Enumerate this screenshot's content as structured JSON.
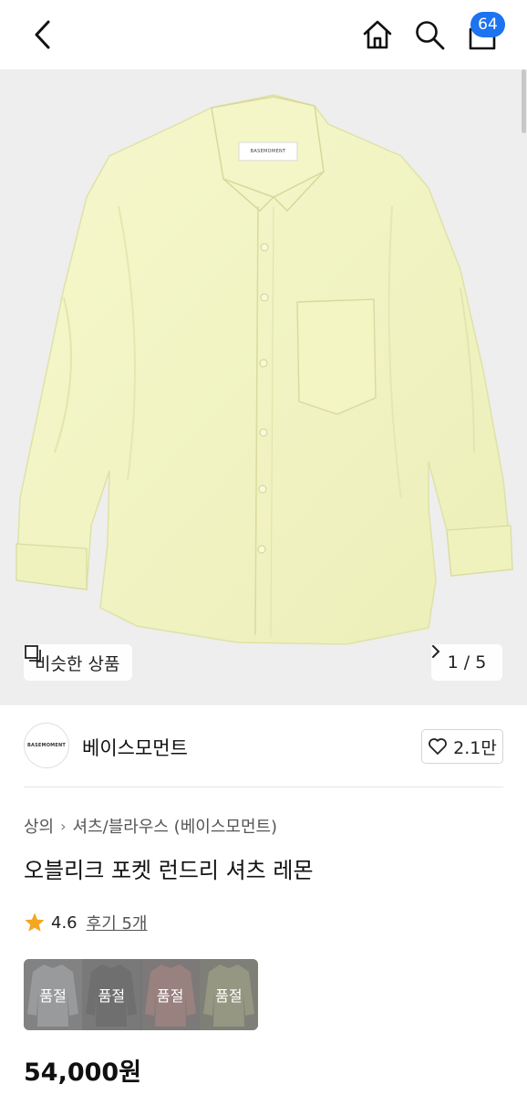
{
  "header": {
    "cart_count": "64",
    "icons": [
      "back-arrow-icon",
      "home-icon",
      "search-icon",
      "cart-icon"
    ]
  },
  "hero": {
    "similar_label": "비슷한 상품",
    "pager": "1 / 5",
    "label_text": "BASEMOMENT",
    "shirt_color": "#f3f5c4"
  },
  "brand": {
    "logo_text": "BASEMOMENT",
    "name": "베이스모먼트",
    "likes": "2.1만"
  },
  "breadcrumb": {
    "items": [
      "상의",
      "셔츠/블라우스 (베이스모먼트)"
    ]
  },
  "product": {
    "title": "오블리크 포켓 런드리 셔츠 레몬",
    "rating": "4.6",
    "review_label": "후기 5개",
    "price": "54,000원"
  },
  "color_options": [
    {
      "status": "품절",
      "color": "#c9ccd0"
    },
    {
      "status": "품절",
      "color": "#8a8a8a"
    },
    {
      "status": "품절",
      "color": "#caa7a3"
    },
    {
      "status": "품절",
      "color": "#c5c8a8"
    }
  ],
  "colors": {
    "accent": "#1d73f0",
    "star": "#f5a623"
  }
}
